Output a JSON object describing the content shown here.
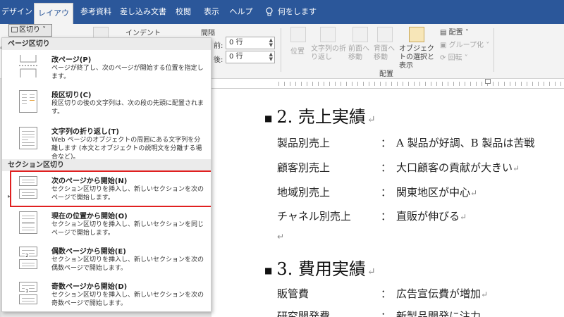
{
  "ribbon_tabs": [
    "デザイン",
    "レイアウト",
    "参考資料",
    "差し込み文書",
    "校閲",
    "表示",
    "ヘルプ"
  ],
  "tell_me": "何をしますか",
  "ribbon": {
    "breaks_button": "区切り",
    "indent_label": "インデント",
    "spacing_label": "間隔",
    "before_label": "前:",
    "after_label": "後:",
    "before_value": "0 行",
    "after_value": "0 行",
    "position_label": "位置",
    "wrap_label": "文字列の折り返し",
    "forward_label": "前面へ移動",
    "backward_label": "背面へ移動",
    "selection_pane_label": "オブジェクトの選択と表示",
    "align_label": "配置",
    "group_label": "グループ化",
    "rotate_label": "回転",
    "arrange_group": "配置"
  },
  "menu": {
    "page_break_section": "ページ区切り",
    "section_break_section": "セクション区切り",
    "items": [
      {
        "title": "改ページ(P)",
        "desc": "ページが終了し、次のページが開始する位置を指定します。"
      },
      {
        "title": "段区切り(C)",
        "desc": "段区切りの後の文字列は、次の段の先頭に配置されます。"
      },
      {
        "title": "文字列の折り返し(T)",
        "desc": "Web ページのオブジェクトの周囲にある文字列を分離します (本文とオブジェクトの説明文を分離する場合など)。"
      },
      {
        "title": "次のページから開始(N)",
        "desc": "セクション区切りを挿入し、新しいセクションを次のページで開始します。"
      },
      {
        "title": "現在の位置から開始(O)",
        "desc": "セクション区切りを挿入し、新しいセクションを同じページで開始します。"
      },
      {
        "title": "偶数ページから開始(E)",
        "desc": "セクション区切りを挿入し、新しいセクションを次の偶数ページで開始します。"
      },
      {
        "title": "奇数ページから開始(D)",
        "desc": "セクション区切りを挿入し、新しいセクションを次の奇数ページで開始します。"
      }
    ],
    "even_badge": "2",
    "odd_badge": "1"
  },
  "document": {
    "heading2": "2. 売上実績",
    "rows1": [
      {
        "label": "製品別売上",
        "value": "A 製品が好調、B 製品は苦戦"
      },
      {
        "label": "顧客別売上",
        "value": "大口顧客の貢献が大きい"
      },
      {
        "label": "地域別売上",
        "value": "関東地区が中心"
      },
      {
        "label": "チャネル別売上",
        "value": "直販が伸びる"
      }
    ],
    "heading3": "3. 費用実績",
    "rows2": [
      {
        "label": "販管費",
        "value": "広告宣伝費が増加"
      },
      {
        "label": "研究開発費",
        "value": "新製品開発に注力"
      }
    ],
    "colon": "："
  },
  "colors": {
    "ribbon_blue": "#2b579a",
    "highlight_red": "#e02020"
  }
}
